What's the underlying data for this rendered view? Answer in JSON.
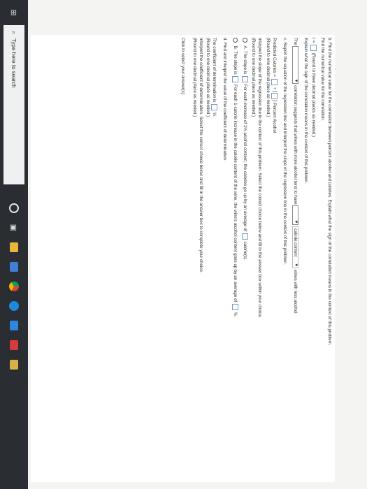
{
  "part_b": {
    "title": "b. Find the numerical value for the correlation between percent alcohol and calories. Explain what the sign of the correlation means in the context of this problem.",
    "find": "Find the numerical value for the correlation.",
    "r_label": "r =",
    "round3": "(Round to three decimal places as needed.)",
    "explain": "Explain what the sign of the correlation means in the context of this problem.",
    "the_label": "The",
    "corr_text": "correlation suggests that wines with more alcohol tend to have",
    "dd2_value": "calorie content",
    "tail": "wines with less alcohol."
  },
  "part_c": {
    "title": "c. Report the equation of the regression line and interpret the slope of the regression line in the context of this problem.",
    "pred_label": "Predicted Calories =",
    "plus": "+",
    "percent_alcohol": "Percent Alcohol",
    "round1": "(Round to one decimal place as needed.)",
    "interpret": "Interpret the slope of the regression line in the context of this problem. Select the correct choice below and fill in the answer box within your choice.",
    "round1b": "(Round to one decimal place as needed.)",
    "opt_a_letter": "A.",
    "opt_a_pre": "The slope is",
    "opt_a_mid": "For each increase of 1% alcohol content, the calories go up by an average of",
    "opt_a_end": "calorie(s).",
    "opt_b_letter": "B.",
    "opt_b_pre": "The slope is",
    "opt_b_mid": "For each 1-calorie increase in the calorie content of the wine, the wine's alcohol content goes up by an average of",
    "opt_b_end": "%."
  },
  "part_d": {
    "title": "d. Find and interpret the value of the coefficient of determination.",
    "coef_label": "The coefficient of determination is",
    "coef_end": "%.",
    "round1": "(Round to one decimal place as needed.)",
    "interpret": "Interpret the coefficient of determination. Select the correct choice below and fill in the answer box to complete your choice.",
    "round1b": "(Round to one decimal place as needed.)"
  },
  "footer": {
    "click_text": "Click to select your answer(s)."
  },
  "taskbar": {
    "search_placeholder": "Type here to search",
    "icons": [
      "windows-start-icon",
      "search-icon",
      "cortana-icon",
      "task-view-icon",
      "file-explorer-icon",
      "store-icon",
      "chrome-icon",
      "edge-icon",
      "mail-icon",
      "office-icon",
      "app-icon"
    ],
    "colors": {
      "background": "#2a2d31",
      "search": "#eef0f2"
    }
  }
}
